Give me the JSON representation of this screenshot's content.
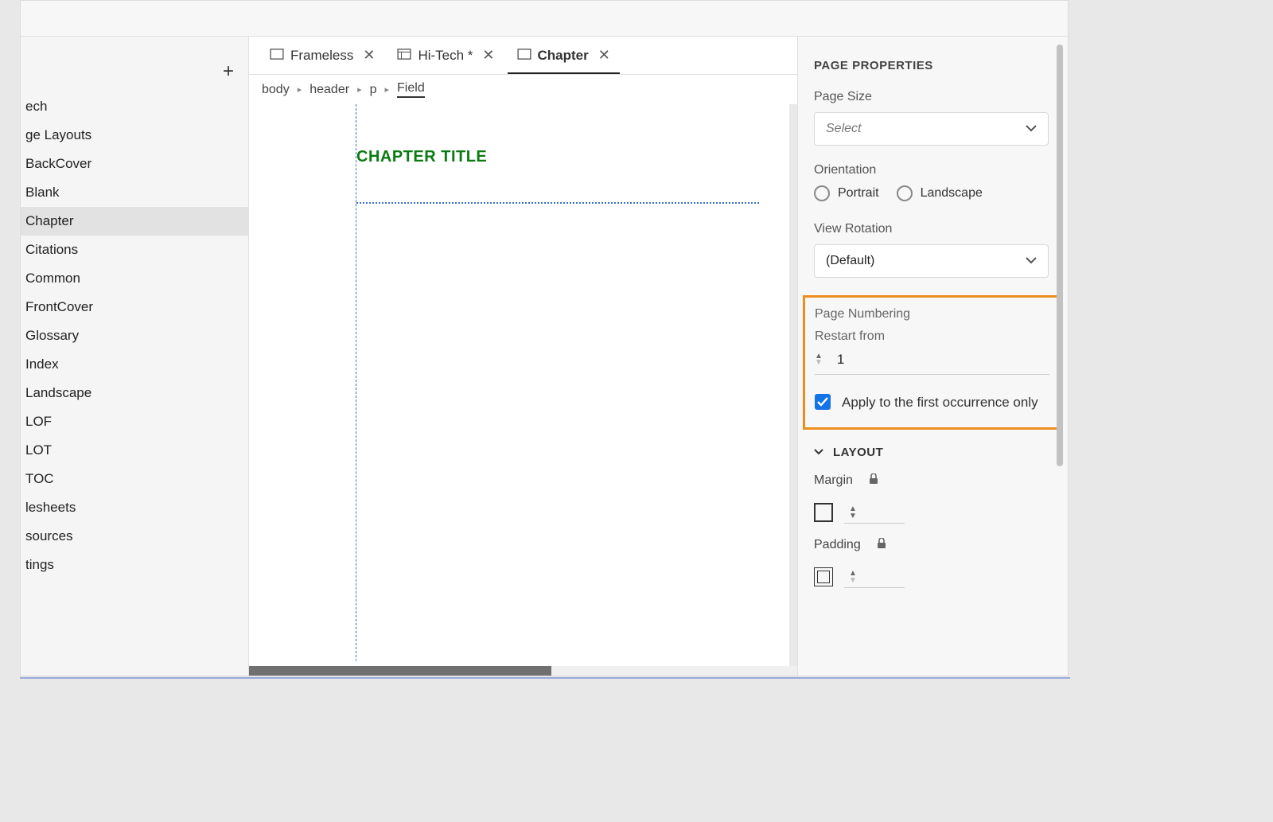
{
  "sidebar": {
    "items": [
      "ech",
      "ge Layouts",
      "BackCover",
      "Blank",
      "Chapter",
      "Citations",
      "Common",
      "FrontCover",
      "Glossary",
      "Index",
      "Landscape",
      "LOF",
      "LOT",
      "TOC",
      "lesheets",
      "sources",
      "tings"
    ],
    "selected_index": 4
  },
  "tabs": [
    {
      "label": "Frameless",
      "dirty": false,
      "active": false
    },
    {
      "label": "Hi-Tech",
      "dirty": true,
      "active": false
    },
    {
      "label": "Chapter",
      "dirty": false,
      "active": true
    }
  ],
  "breadcrumb": [
    "body",
    "header",
    "p",
    "Field"
  ],
  "canvas": {
    "header_text": "CHAPTER TITLE"
  },
  "panel": {
    "title": "PAGE PROPERTIES",
    "page_size": {
      "label": "Page Size",
      "placeholder": "Select"
    },
    "orientation": {
      "label": "Orientation",
      "options": [
        "Portrait",
        "Landscape"
      ]
    },
    "view_rotation": {
      "label": "View Rotation",
      "value": "(Default)"
    },
    "page_numbering": {
      "label": "Page Numbering",
      "restart_label": "Restart from",
      "restart_value": "1",
      "apply_first_label": "Apply to the first occurrence only",
      "apply_first_checked": true
    },
    "layout": {
      "title": "LAYOUT",
      "margin_label": "Margin",
      "padding_label": "Padding"
    }
  }
}
